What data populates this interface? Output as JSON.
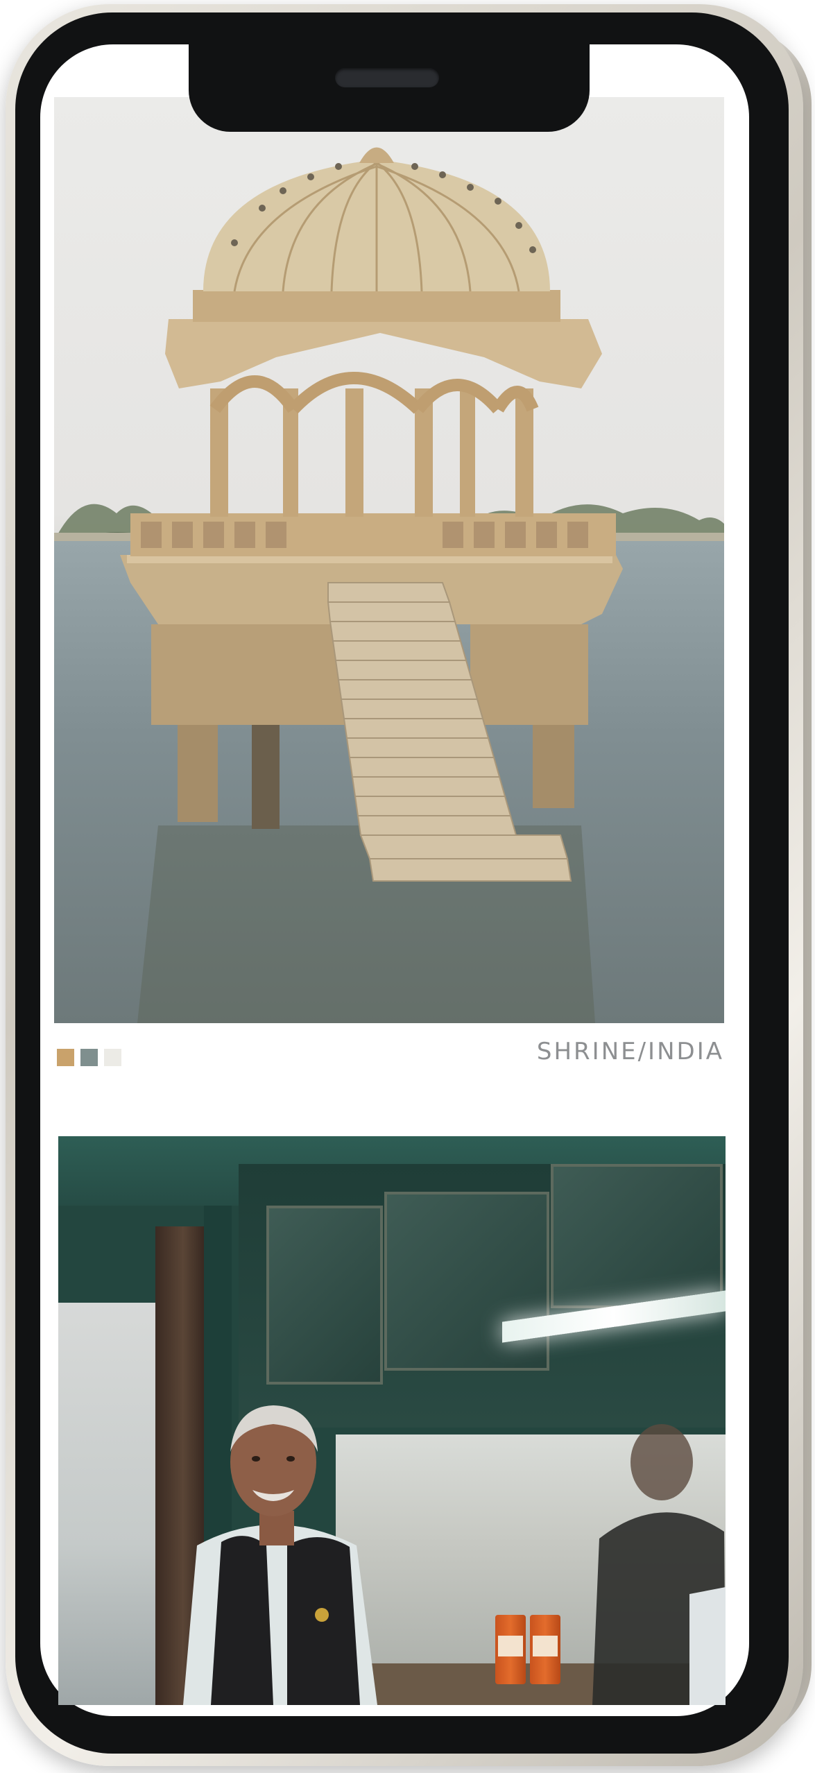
{
  "photo_1": {
    "subject": "shrine",
    "caption": "SHRINE/INDIA",
    "palette": [
      "#c9a26b",
      "#7f8f8e",
      "#ecebe6"
    ]
  },
  "photo_2": {
    "subject": "shop"
  },
  "colors": {
    "phone_frame": "#111213",
    "screen_bg": "#ffffff",
    "caption_text": "#8d8f91"
  }
}
